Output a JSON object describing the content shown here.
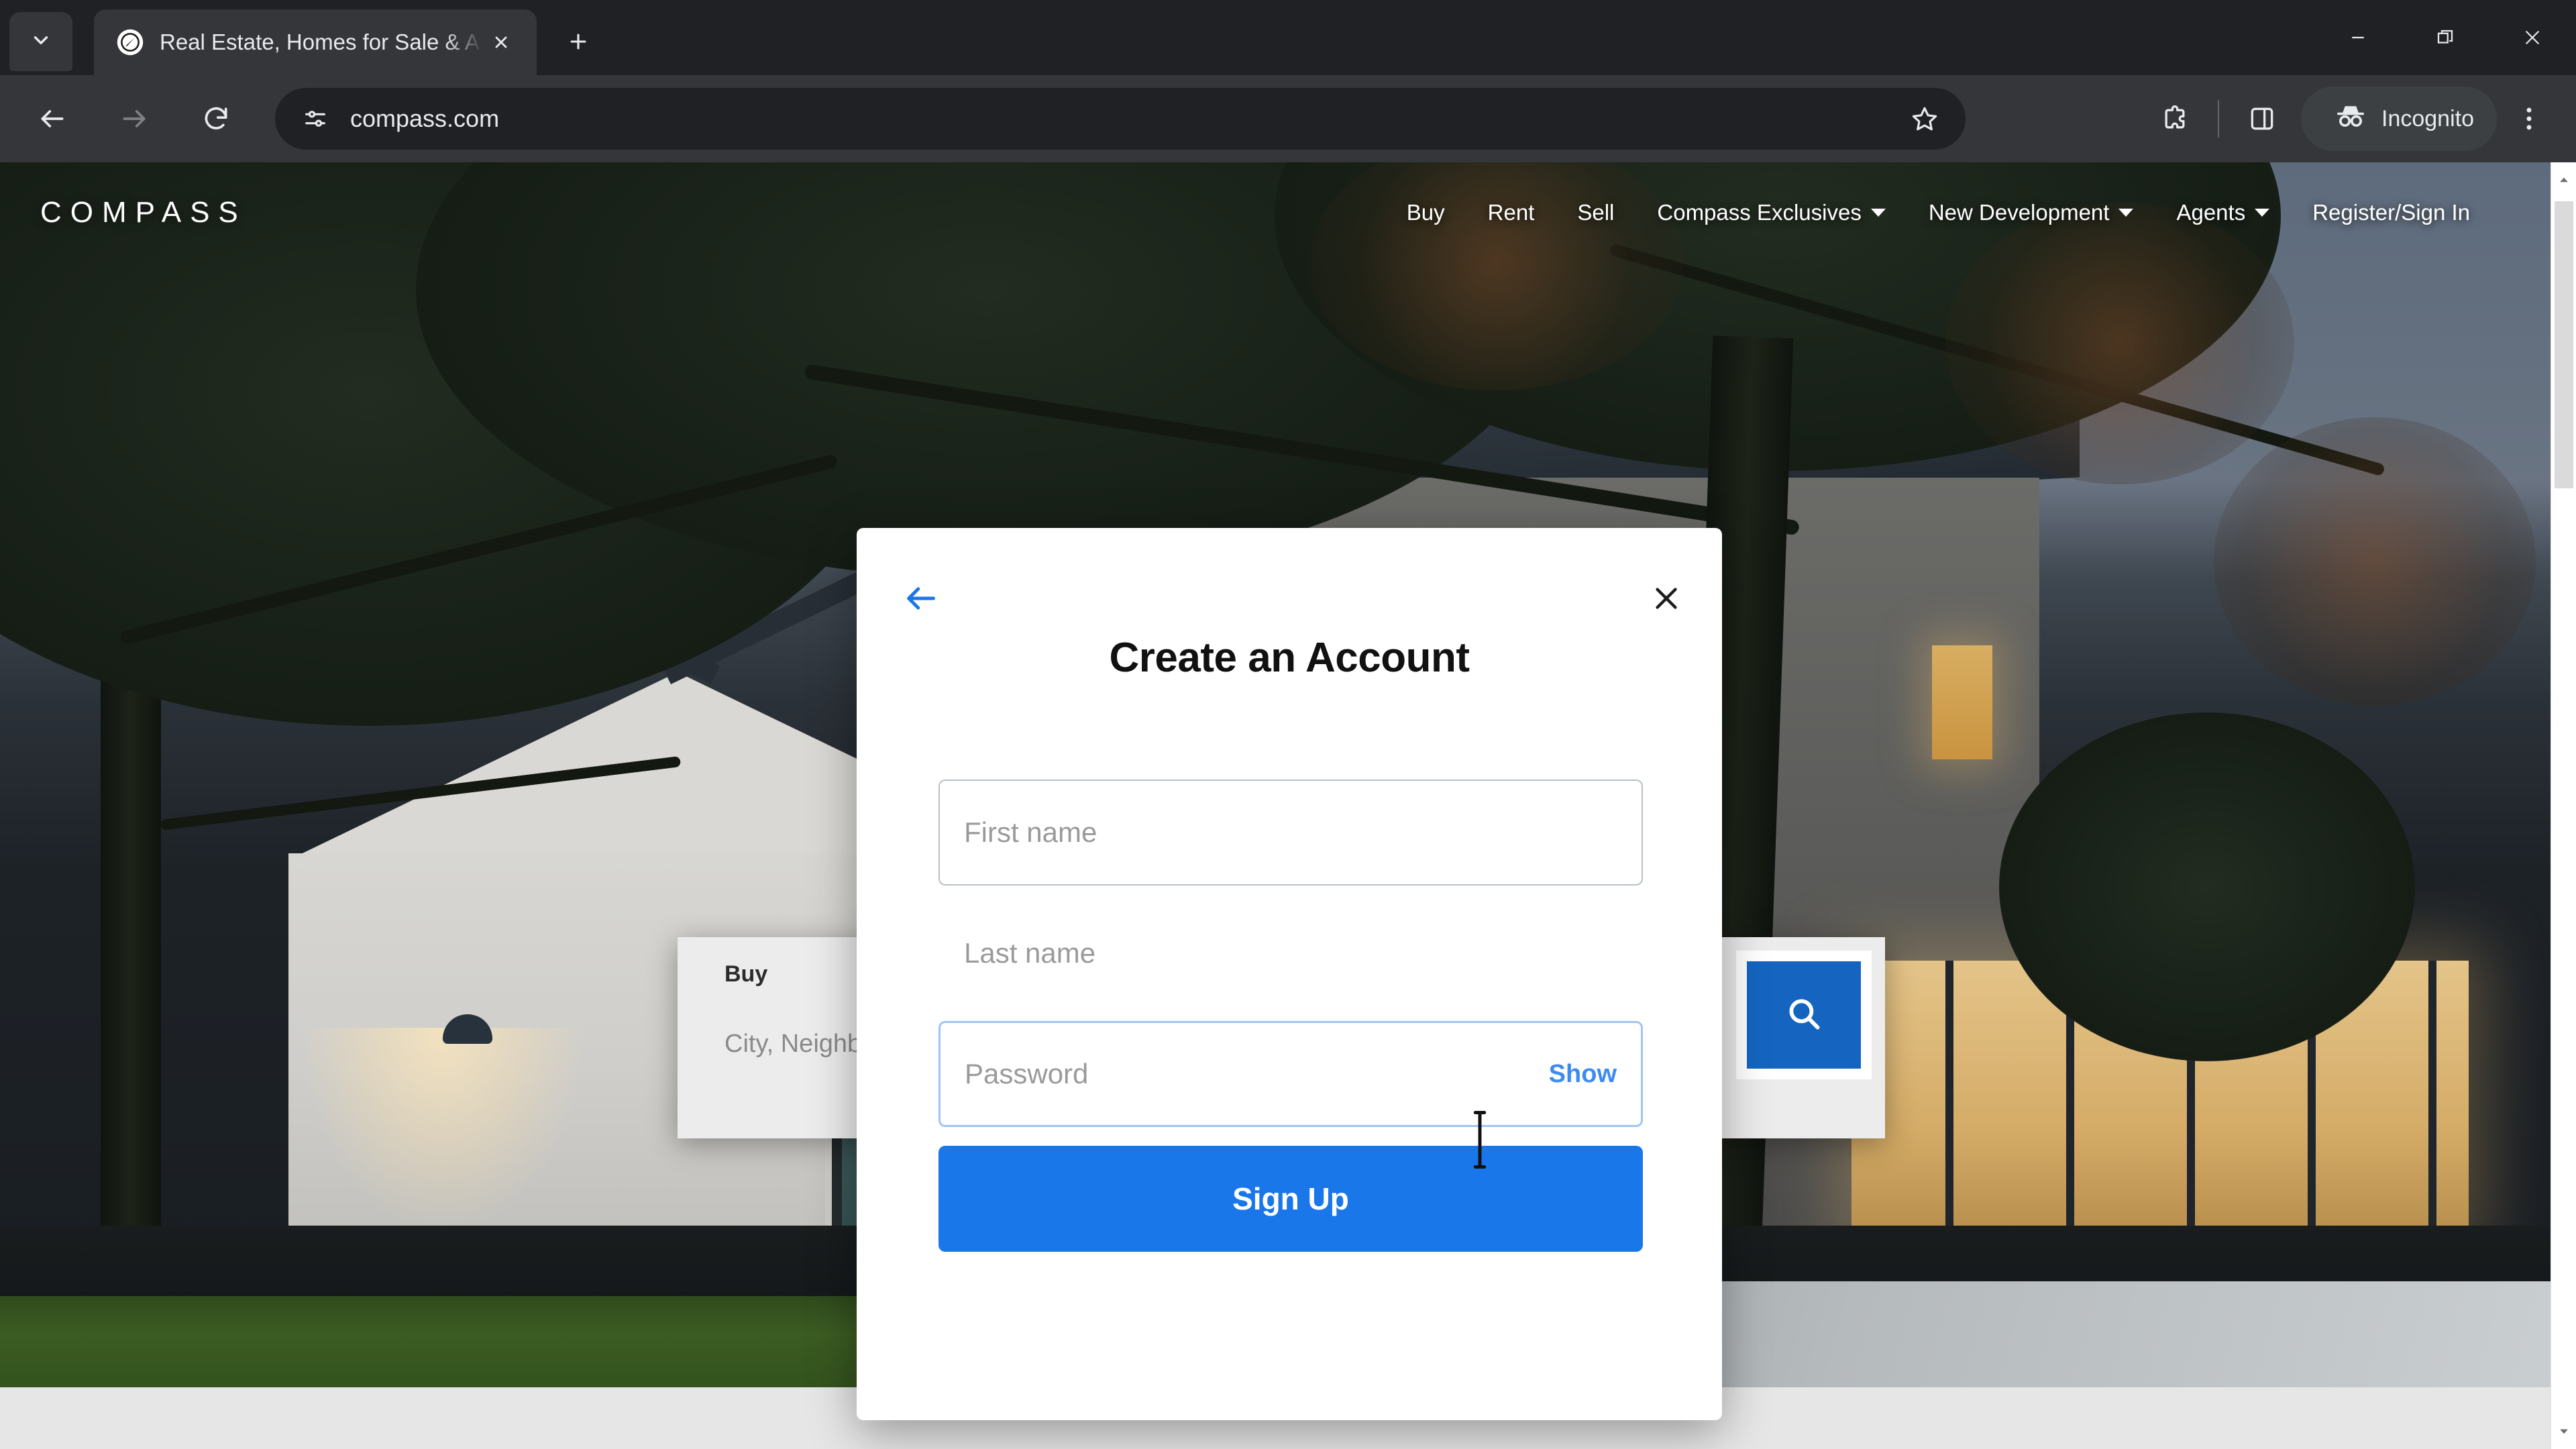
{
  "browser": {
    "tab": {
      "title": "Real Estate, Homes for Sale & A",
      "favicon_icon": "compass-favicon-icon",
      "close_icon": "tab-close-icon"
    },
    "tab_search_icon": "tab-search-chevron-icon",
    "new_tab_icon": "new-tab-plus-icon",
    "window_controls": {
      "minimize_icon": "minimize-icon",
      "maximize_icon": "restore-window-icon",
      "close_icon": "window-close-icon"
    },
    "toolbar": {
      "back_icon": "back-arrow-icon",
      "forward_icon": "forward-arrow-icon",
      "reload_icon": "reload-icon",
      "site_info_icon": "site-settings-tune-icon",
      "url": "compass.com",
      "bookmark_icon": "bookmark-star-icon",
      "extensions_icon": "extensions-puzzle-icon",
      "side_panel_icon": "side-panel-icon",
      "incognito_label": "Incognito",
      "incognito_icon": "incognito-hat-icon",
      "menu_icon": "three-dot-menu-icon"
    }
  },
  "site": {
    "logo": "COMPASS",
    "nav": [
      {
        "label": "Buy",
        "has_caret": false
      },
      {
        "label": "Rent",
        "has_caret": false
      },
      {
        "label": "Sell",
        "has_caret": false
      },
      {
        "label": "Compass Exclusives",
        "has_caret": true
      },
      {
        "label": "New Development",
        "has_caret": true
      },
      {
        "label": "Agents",
        "has_caret": true
      },
      {
        "label": "Register/Sign In",
        "has_caret": false
      }
    ],
    "search_widget": {
      "tab": "Buy",
      "placeholder": "City, Neighborhood, Address, School, ZIP, Agent, ID",
      "submit_icon": "search-magnifier-icon"
    }
  },
  "modal": {
    "back_icon": "back-arrow-icon",
    "close_icon": "close-x-icon",
    "title": "Create an Account",
    "fields": [
      {
        "name": "first-name",
        "placeholder": "First name",
        "value": "",
        "state": "bordered"
      },
      {
        "name": "last-name",
        "placeholder": "Last name",
        "value": "",
        "state": "bare"
      },
      {
        "name": "password",
        "placeholder": "Password",
        "value": "",
        "state": "focused",
        "action_label": "Show"
      }
    ],
    "submit_label": "Sign Up"
  },
  "colors": {
    "accent_blue": "#1a77ea",
    "link_blue": "#3d8bf2",
    "chrome_dark": "#202124",
    "toolbar_dark": "#35363a",
    "search_button_blue": "#1565c0"
  },
  "scrollbar": {
    "up_arrow_icon": "scroll-up-arrow-icon",
    "down_arrow_icon": "scroll-down-arrow-icon"
  }
}
